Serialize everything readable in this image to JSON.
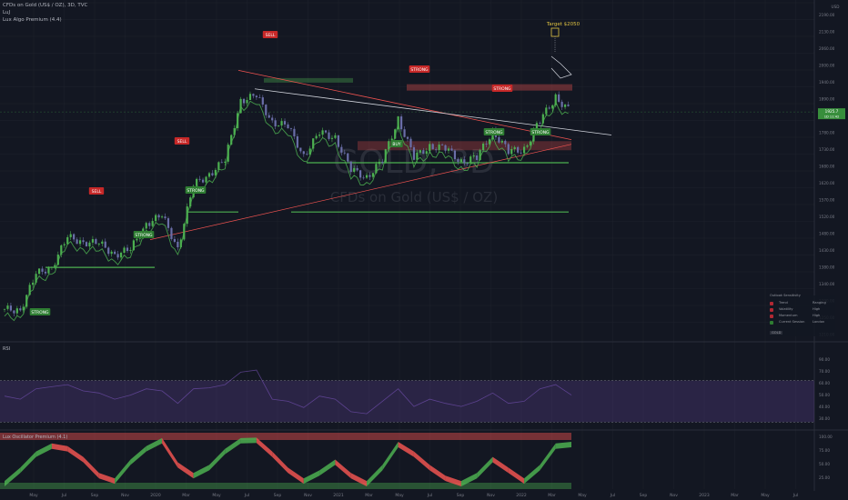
{
  "header": {
    "symbol_line": "CFDs on Gold (US$ / OZ), 3D, TVC",
    "indicator_1": "LuJ",
    "indicator_2": "Lux Algo Premium (4.4)"
  },
  "watermark": {
    "main": "GOLD, 3D",
    "sub": "CFDs on Gold (US$ / OZ)"
  },
  "price_axis": {
    "currency": "USD",
    "ticks": [
      "2190.00",
      "2130.00",
      "2060.00",
      "2000.00",
      "1940.00",
      "1890.00",
      "1830.00",
      "1780.00",
      "1730.00",
      "1680.00",
      "1620.00",
      "1570.00",
      "1520.00",
      "1480.00",
      "1430.00",
      "1380.00",
      "1340.00",
      "1290.00",
      "1250.00",
      "1210.00"
    ],
    "current_price": "1925.7",
    "current_sub": "1D 11:42"
  },
  "time_axis": {
    "ticks": [
      "May",
      "Jul",
      "Sep",
      "Nov",
      "2020",
      "Mar",
      "May",
      "Jul",
      "Sep",
      "Nov",
      "2021",
      "Mar",
      "May",
      "Jul",
      "Sep",
      "Nov",
      "2022",
      "Mar",
      "May",
      "Jul",
      "Sep",
      "Nov",
      "2023",
      "Mar",
      "May",
      "Jul"
    ]
  },
  "annotations": {
    "target_label": "Target $2050",
    "signals": [
      {
        "text": "SELL",
        "kind": "sell"
      },
      {
        "text": "SELL",
        "kind": "sell"
      },
      {
        "text": "SELL",
        "kind": "sell"
      },
      {
        "text": "STRONG",
        "kind": "sell"
      },
      {
        "text": "STRONG",
        "kind": "sell"
      },
      {
        "text": "STRONG",
        "kind": "buy"
      },
      {
        "text": "STRONG",
        "kind": "buy"
      },
      {
        "text": "STRONG",
        "kind": "buy"
      },
      {
        "text": "BUY",
        "kind": "buy"
      },
      {
        "text": "STRONG",
        "kind": "buy"
      },
      {
        "text": "STRONG",
        "kind": "buy"
      }
    ]
  },
  "rsi_pane": {
    "label": "RSI",
    "ticks": [
      "90.00",
      "70.00",
      "60.00",
      "50.00",
      "40.00",
      "30.00"
    ]
  },
  "osc_pane": {
    "label": "Lux Oscillator Premium (4.1)",
    "ticks": [
      "100.00",
      "75.00",
      "50.00",
      "25.00"
    ]
  },
  "legend": {
    "header": "Outlook  Sensitivity",
    "rows": [
      {
        "key": "Trend",
        "value": "Ranging",
        "color": "#b22833"
      },
      {
        "key": "Volatility",
        "value": "High",
        "color": "#b22833"
      },
      {
        "key": "Momentum",
        "value": "High",
        "color": "#b22833"
      },
      {
        "key": "Current Session",
        "value": "London"
      }
    ],
    "tag": "GOLD"
  },
  "colors": {
    "background": "#131722",
    "bull": "#26a69a",
    "bull_bright": "#4caf50",
    "bear": "#ef5350",
    "sell_tag": "#c62828",
    "buy_tag": "#2e7d32",
    "target": "#e0c341",
    "rsi_band": "#7e57c2"
  },
  "chart_data": [
    {
      "type": "candlestick",
      "title": "CFDs on Gold (US$ / OZ), 3D, TVC",
      "ylim": [
        1190,
        2200
      ],
      "x": [
        "2019-04",
        "2019-05",
        "2019-06",
        "2019-07",
        "2019-08",
        "2019-09",
        "2019-10",
        "2019-11",
        "2019-12",
        "2020-01",
        "2020-02",
        "2020-03",
        "2020-04",
        "2020-05",
        "2020-06",
        "2020-07",
        "2020-08",
        "2020-09",
        "2020-10",
        "2020-11",
        "2020-12",
        "2021-01",
        "2021-02",
        "2021-03",
        "2021-04",
        "2021-05",
        "2021-06",
        "2021-07",
        "2021-08",
        "2021-09",
        "2021-10",
        "2021-11",
        "2021-12",
        "2022-01",
        "2022-02",
        "2022-03",
        "2022-04"
      ],
      "close": [
        1285,
        1280,
        1400,
        1420,
        1520,
        1500,
        1500,
        1460,
        1480,
        1560,
        1590,
        1480,
        1690,
        1720,
        1770,
        1960,
        1980,
        1890,
        1880,
        1780,
        1860,
        1840,
        1740,
        1710,
        1770,
        1900,
        1780,
        1810,
        1810,
        1760,
        1780,
        1860,
        1800,
        1800,
        1900,
        1970,
        1925
      ],
      "high": [
        1300,
        1300,
        1420,
        1440,
        1560,
        1540,
        1520,
        1490,
        1520,
        1600,
        1690,
        1700,
        1750,
        1770,
        1800,
        1990,
        2075,
        1970,
        1930,
        1960,
        1880,
        1960,
        1870,
        1760,
        1800,
        1920,
        1910,
        1840,
        1830,
        1830,
        1820,
        1880,
        1830,
        1830,
        1920,
        2070,
        1970
      ],
      "low": [
        1270,
        1265,
        1285,
        1385,
        1440,
        1480,
        1480,
        1445,
        1460,
        1540,
        1560,
        1455,
        1600,
        1680,
        1690,
        1760,
        1870,
        1850,
        1850,
        1760,
        1770,
        1800,
        1700,
        1680,
        1680,
        1770,
        1750,
        1790,
        1690,
        1740,
        1740,
        1780,
        1760,
        1780,
        1790,
        1890,
        1900
      ]
    },
    {
      "type": "line",
      "series": [
        {
          "name": "RSI",
          "values": [
            55,
            52,
            62,
            64,
            66,
            60,
            58,
            52,
            56,
            62,
            60,
            48,
            62,
            63,
            66,
            78,
            80,
            52,
            50,
            44,
            55,
            52,
            40,
            38,
            50,
            62,
            45,
            52,
            48,
            45,
            50,
            58,
            48,
            50,
            62,
            66,
            56
          ]
        }
      ],
      "ylim": [
        25,
        95
      ]
    },
    {
      "type": "area",
      "series": [
        {
          "name": "Lux Oscillator Premium (4.1)",
          "values": [
            15,
            40,
            70,
            85,
            80,
            60,
            30,
            20,
            55,
            80,
            95,
            50,
            30,
            45,
            75,
            95,
            96,
            70,
            40,
            20,
            35,
            55,
            30,
            15,
            45,
            88,
            70,
            45,
            25,
            15,
            30,
            60,
            40,
            20,
            45,
            85,
            88
          ]
        }
      ],
      "ylim": [
        0,
        105
      ]
    }
  ]
}
